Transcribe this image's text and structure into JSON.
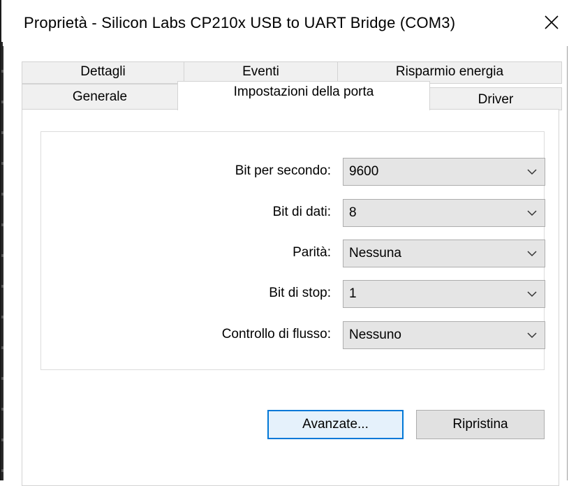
{
  "window": {
    "title": "Proprietà - Silicon Labs CP210x USB to UART Bridge (COM3)",
    "close_icon": "close-icon"
  },
  "tabs": {
    "row1": [
      {
        "label": "Dettagli"
      },
      {
        "label": "Eventi"
      },
      {
        "label": "Risparmio energia"
      }
    ],
    "row2": [
      {
        "label": "Generale"
      },
      {
        "label": "Impostazioni della porta",
        "active": true
      },
      {
        "label": "Driver"
      }
    ]
  },
  "settings": {
    "bits_per_second": {
      "label": "Bit per secondo:",
      "value": "9600"
    },
    "data_bits": {
      "label": "Bit di dati:",
      "value": "8"
    },
    "parity": {
      "label": "Parità:",
      "value": "Nessuna"
    },
    "stop_bits": {
      "label": "Bit di stop:",
      "value": "1"
    },
    "flow_control": {
      "label": "Controllo di flusso:",
      "value": "Nessuno"
    }
  },
  "buttons": {
    "advanced": "Avanzate...",
    "restore": "Ripristina"
  },
  "colors": {
    "focus_border": "#0078d7",
    "combo_bg": "#e5e5e5",
    "tab_bg": "#f0f0f0"
  }
}
